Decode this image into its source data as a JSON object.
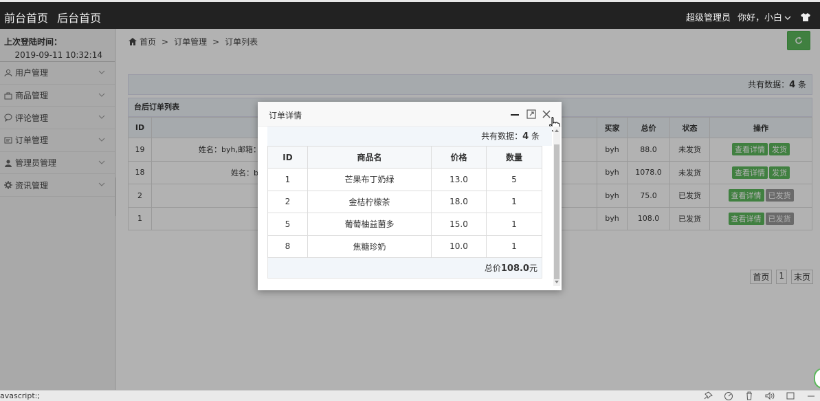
{
  "topbar": {
    "nav": [
      "前台首页",
      "后台首页"
    ],
    "admin_role": "超级管理员",
    "greeting": "你好，小白",
    "shirt_icon": "tshirt-icon"
  },
  "sidebar": {
    "login_label": "上次登陆时间：",
    "login_time": "2019-09-11 10:32:14",
    "items": [
      {
        "label": "用户管理",
        "icon": "user-icon"
      },
      {
        "label": "商品管理",
        "icon": "bag-icon"
      },
      {
        "label": "评论管理",
        "icon": "comment-icon"
      },
      {
        "label": "订单管理",
        "icon": "order-icon"
      },
      {
        "label": "管理员管理",
        "icon": "admin-icon"
      },
      {
        "label": "资讯管理",
        "icon": "gear-icon"
      }
    ]
  },
  "breadcrumb": {
    "home": "首页",
    "level1": "订单管理",
    "level2": "订单列表",
    "separator": ">"
  },
  "orders": {
    "count_label": "共有数据：",
    "count_value": "4",
    "count_unit": "条",
    "table_title": "台后订单列表",
    "headers": [
      "ID",
      "",
      "买家",
      "总价",
      "状态",
      "操作"
    ],
    "rows": [
      {
        "id": "19",
        "info": "姓名：byh,邮箱：",
        "buyer": "byh",
        "total": "88.0",
        "status": "未发货",
        "detail": "查看详情",
        "ship": "发货"
      },
      {
        "id": "18",
        "info": "姓名：b",
        "buyer": "byh",
        "total": "1078.0",
        "status": "未发货",
        "detail": "查看详情",
        "ship": "发货"
      },
      {
        "id": "2",
        "info": "",
        "buyer": "byh",
        "total": "75.0",
        "status": "已发货",
        "detail": "查看详情",
        "ship": "已发货"
      },
      {
        "id": "1",
        "info": "",
        "buyer": "byh",
        "total": "108.0",
        "status": "已发货",
        "detail": "查看详情",
        "ship": "已发货"
      }
    ]
  },
  "pager": {
    "first": "首页",
    "page": "1",
    "last": "末页"
  },
  "modal": {
    "title": "订单详情",
    "count_label": "共有数据：",
    "count_value": "4",
    "count_unit": "条",
    "headers": [
      "ID",
      "商品名",
      "价格",
      "数量"
    ],
    "items": [
      {
        "id": "1",
        "name": "芒果布丁奶绿",
        "price": "13.0",
        "qty": "5"
      },
      {
        "id": "2",
        "name": "金桔柠檬茶",
        "price": "18.0",
        "qty": "1"
      },
      {
        "id": "5",
        "name": "葡萄柚益菌多",
        "price": "15.0",
        "qty": "1"
      },
      {
        "id": "8",
        "name": "焦糖珍奶",
        "price": "10.0",
        "qty": "1"
      }
    ],
    "total_label": "总价",
    "total_value": "108.0",
    "total_unit": "元"
  },
  "statusbar": {
    "text": "avascript:;"
  },
  "colors": {
    "accent_green": "#5cb85c",
    "topbar": "#222222"
  }
}
